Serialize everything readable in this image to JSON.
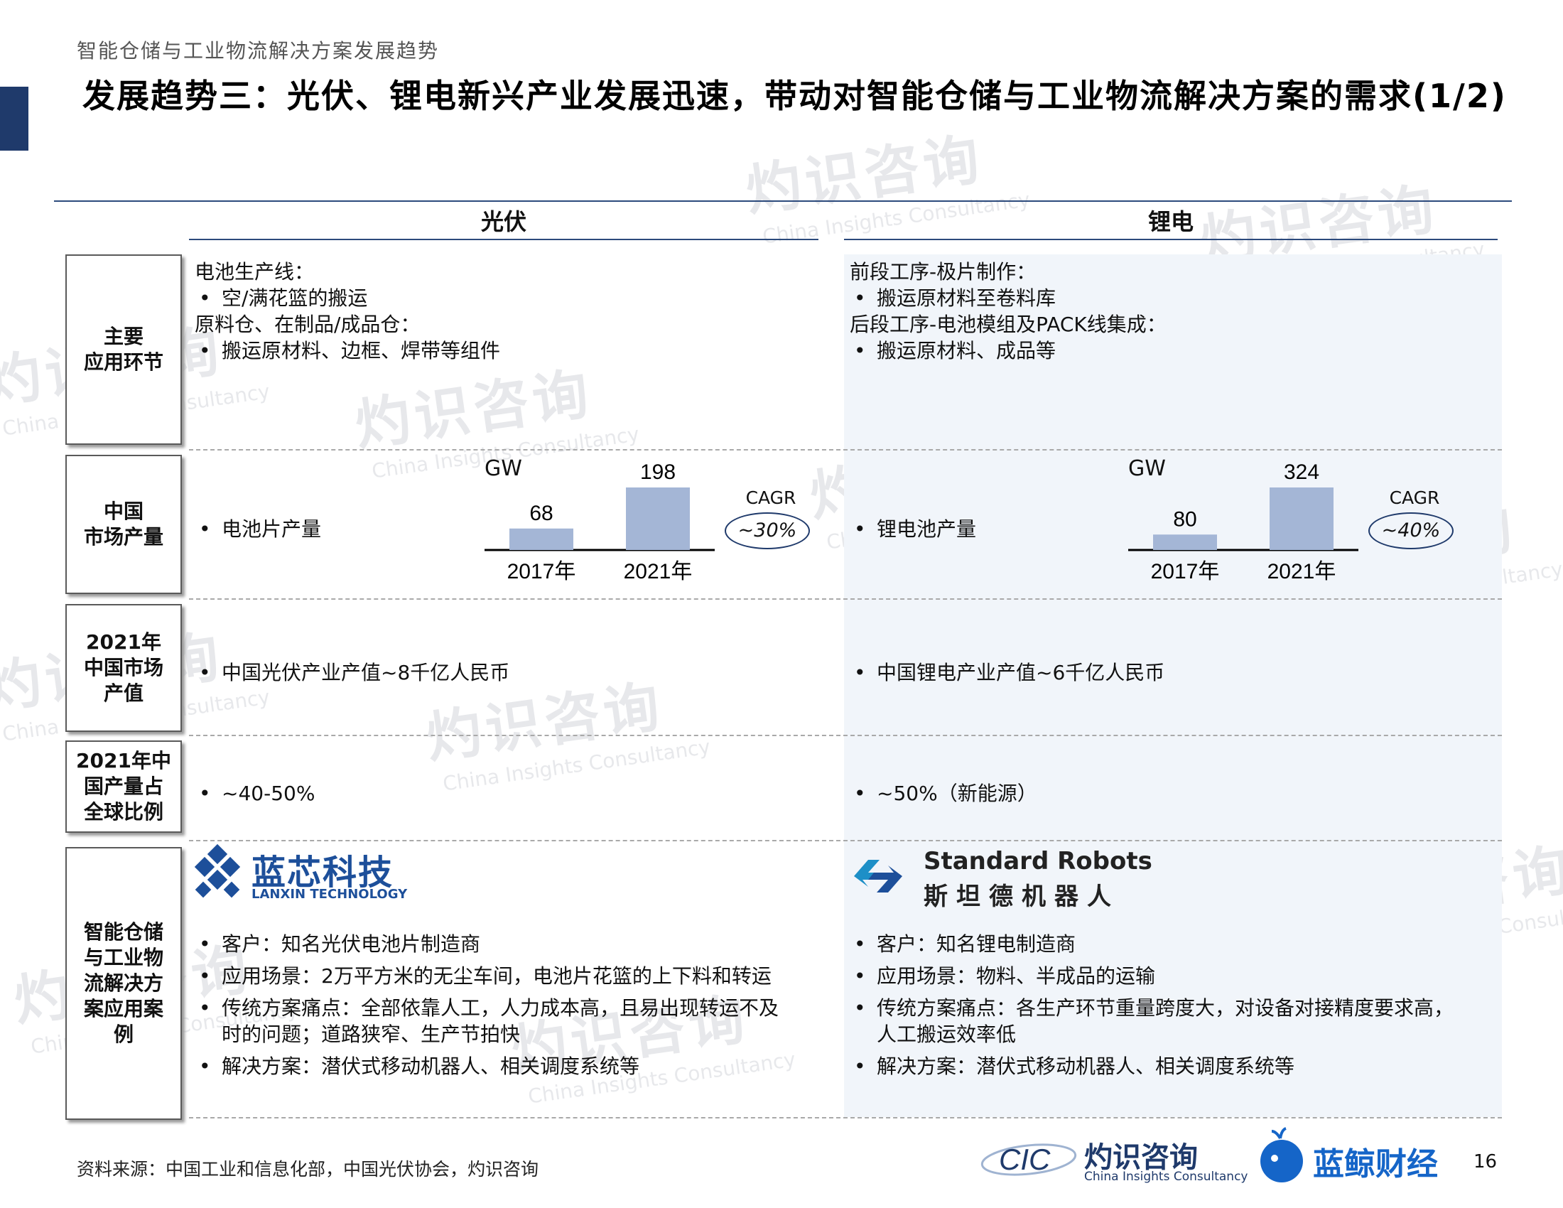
{
  "header": {
    "breadcrumb": "智能仓储与工业物流解决方案发展趋势",
    "title": "发展趋势三：光伏、锂电新兴产业发展迅速，带动对智能仓储与工业物流解决方案的需求(1/2)"
  },
  "columns": {
    "pv": "光伏",
    "li": "锂电"
  },
  "rows": {
    "application": {
      "label": "主要\n应用环节",
      "pv": [
        "电池生产线：",
        "空/满花篮的搬运",
        "原料仓、在制品/成品仓：",
        "搬运原材料、边框、焊带等组件"
      ],
      "li": [
        "前段工序-极片制作：",
        "搬运原材料至卷料库",
        "后段工序-电池模组及PACK线集成：",
        "搬运原材料、成品等"
      ]
    },
    "output": {
      "label": "中国\n市场产量",
      "pv_item": "电池片产量",
      "li_item": "锂电池产量"
    },
    "value": {
      "label": "2021年\n中国市场\n产值",
      "pv": "中国光伏产业产值~8千亿人民币",
      "li": "中国锂电产业产值~6千亿人民币"
    },
    "share": {
      "label": "2021年中\n国产量占\n全球比例",
      "pv": "~40-50%",
      "li": "~50%（新能源）"
    },
    "cases": {
      "label": "智能仓储\n与工业物\n流解决方\n案应用案\n例",
      "pv": [
        "客户：知名光伏电池片制造商",
        "应用场景：2万平方米的无尘车间，电池片花篮的上下料和转运",
        "传统方案痛点：全部依靠人工，人力成本高，且易出现转运不及",
        "时的问题；道路狭窄、生产节拍快",
        "解决方案：潜伏式移动机器人、相关调度系统等"
      ],
      "li": [
        "客户：知名锂电制造商",
        "应用场景：物料、半成品的运输",
        "传统方案痛点：各生产环节重量跨度大，对设备对接精度要求高，",
        "人工搬运效率低",
        "解决方案：潜伏式移动机器人、相关调度系统等"
      ]
    }
  },
  "logos": {
    "lanxin_cn": "蓝芯科技",
    "lanxin_en": "LANXIN TECHNOLOGY",
    "sr_en": "Standard Robots",
    "sr_cn": "斯坦德机器人",
    "cic_mark": "CIC",
    "cic_cn": "灼识咨询",
    "cic_en": "China Insights Consultancy",
    "lj_cn": "蓝鲸财经"
  },
  "watermark": {
    "cn": "灼识咨询",
    "en": "China Insights Consultancy",
    "mark": "CIC"
  },
  "footer": {
    "source": "资料来源：中国工业和信息化部，中国光伏协会，灼识咨询",
    "page": "16"
  },
  "colors": {
    "accent": "#1f3a6b",
    "bar": "#a4b6d6",
    "lithium_bg": "#f1f5fa"
  },
  "chart_data": [
    {
      "type": "bar",
      "ylabel": "GW",
      "categories": [
        "2017年",
        "2021年"
      ],
      "values": [
        68,
        198
      ],
      "cagr_label": "CAGR",
      "cagr_value": "~30%"
    },
    {
      "type": "bar",
      "ylabel": "GW",
      "categories": [
        "2017年",
        "2021年"
      ],
      "values": [
        80,
        324
      ],
      "cagr_label": "CAGR",
      "cagr_value": "~40%"
    }
  ]
}
